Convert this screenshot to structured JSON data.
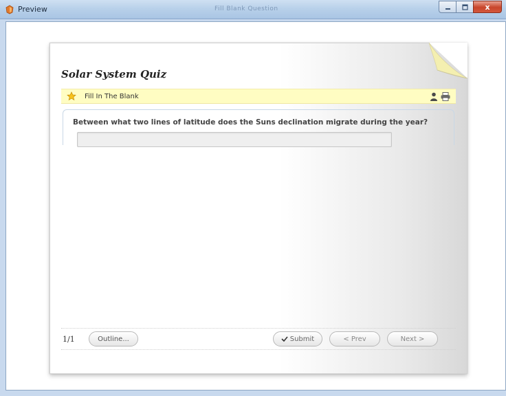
{
  "window": {
    "title": "Preview",
    "center_title": "Fill Blank Question",
    "buttons": {
      "minimize": "_",
      "maximize": "□",
      "close": "x"
    }
  },
  "quiz": {
    "title": "Solar System Quiz",
    "question_type": "Fill In The Blank",
    "question": "Between what two lines of latitude does the Suns declination migrate during the year?",
    "answer_value": "",
    "answer_placeholder": ""
  },
  "footer": {
    "counter": "1/1",
    "outline_label": "Outline...",
    "submit_label": "Submit",
    "prev_label": "< Prev",
    "next_label": "Next >"
  },
  "icons": {
    "app": "app-icon",
    "star": "star-icon",
    "person": "person-icon",
    "printer": "printer-icon",
    "check": "check-icon"
  },
  "colors": {
    "question_type_bar": "#fffdc2",
    "title_bar": "#b9d1ea",
    "close_button": "#c8452a"
  }
}
